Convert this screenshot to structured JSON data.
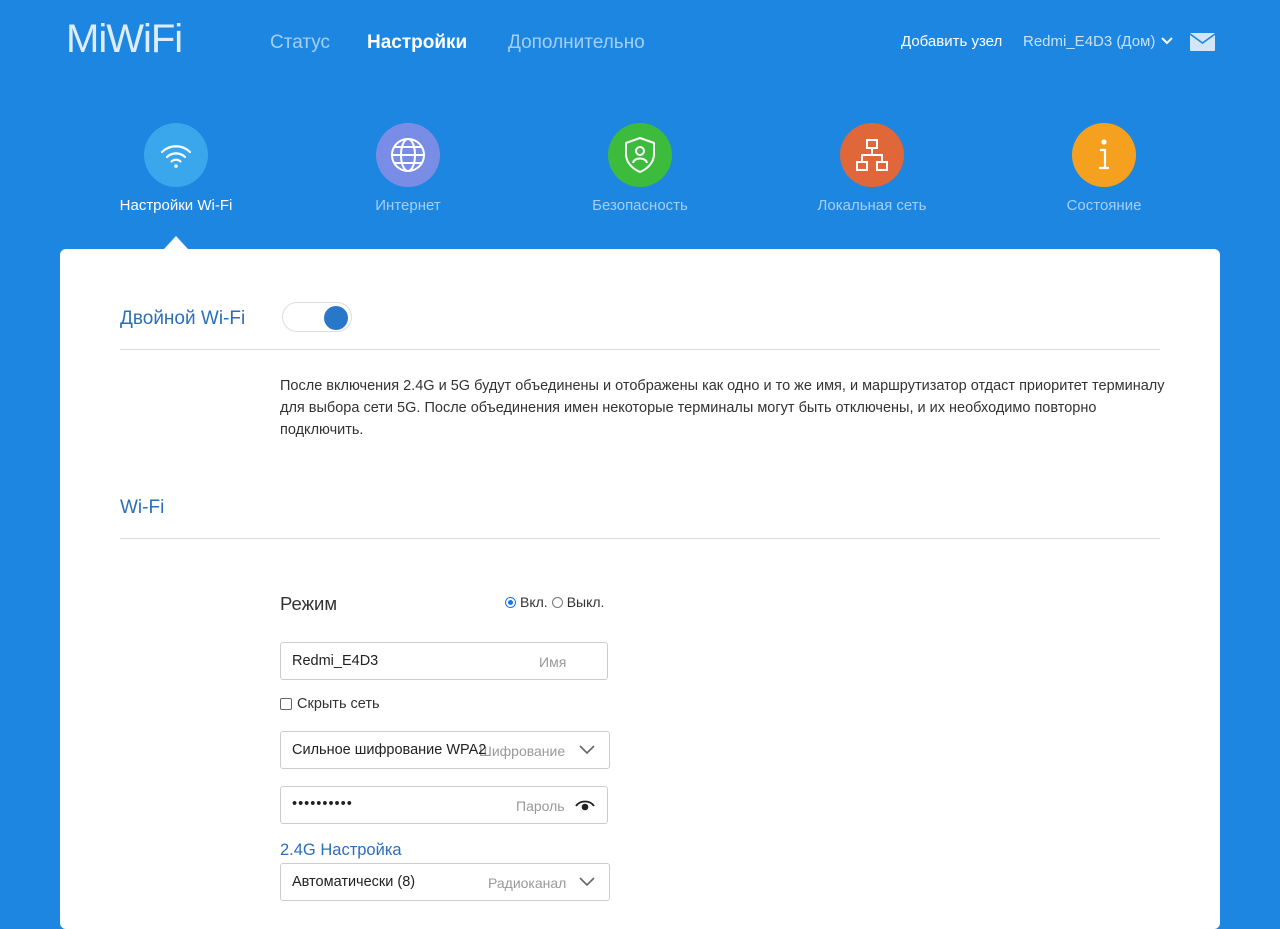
{
  "header": {
    "logo": "MiWiFi",
    "nav": [
      {
        "label": "Статус",
        "active": false
      },
      {
        "label": "Настройки",
        "active": true
      },
      {
        "label": "Дополнительно",
        "active": false
      }
    ],
    "add_node": "Добавить узел",
    "device": "Redmi_E4D3 (Дом)"
  },
  "categories": [
    {
      "label": "Настройки Wi-Fi",
      "color": "#3aa6ec",
      "icon": "wifi-icon",
      "active": true
    },
    {
      "label": "Интернет",
      "color": "#7a8de6",
      "icon": "globe-icon",
      "active": false
    },
    {
      "label": "Безопасность",
      "color": "#3dbb3d",
      "icon": "shield-icon",
      "active": false
    },
    {
      "label": "Локальная сеть",
      "color": "#e0673a",
      "icon": "network-icon",
      "active": false
    },
    {
      "label": "Состояние",
      "color": "#f5a11f",
      "icon": "info-icon",
      "active": false
    }
  ],
  "dual_wifi": {
    "title": "Двойной Wi-Fi",
    "enabled": true,
    "description": "После включения 2.4G и 5G будут объединены и отображены как одно и то же имя, и маршрутизатор отдаст приоритет терминалу для выбора сети 5G. После объединения имен некоторые терминалы могут быть отключены, и их необходимо повторно подключить."
  },
  "wifi": {
    "title": "Wi-Fi",
    "mode_label": "Режим",
    "mode_on": "Вкл.",
    "mode_off": "Выкл.",
    "ssid_value": "Redmi_E4D3",
    "ssid_placeholder": "Имя",
    "hide_network": "Скрыть сеть",
    "encryption_value": "Сильное шифрование WPA2",
    "encryption_placeholder": "Шифрование",
    "password_value": "••••••••••",
    "password_placeholder": "Пароль",
    "band_title": "2.4G Настройка",
    "channel_value": "Автоматически (8)",
    "channel_placeholder": "Радиоканал"
  },
  "colors": {
    "background": "#1d86e0",
    "accent": "#2a6fb8"
  }
}
